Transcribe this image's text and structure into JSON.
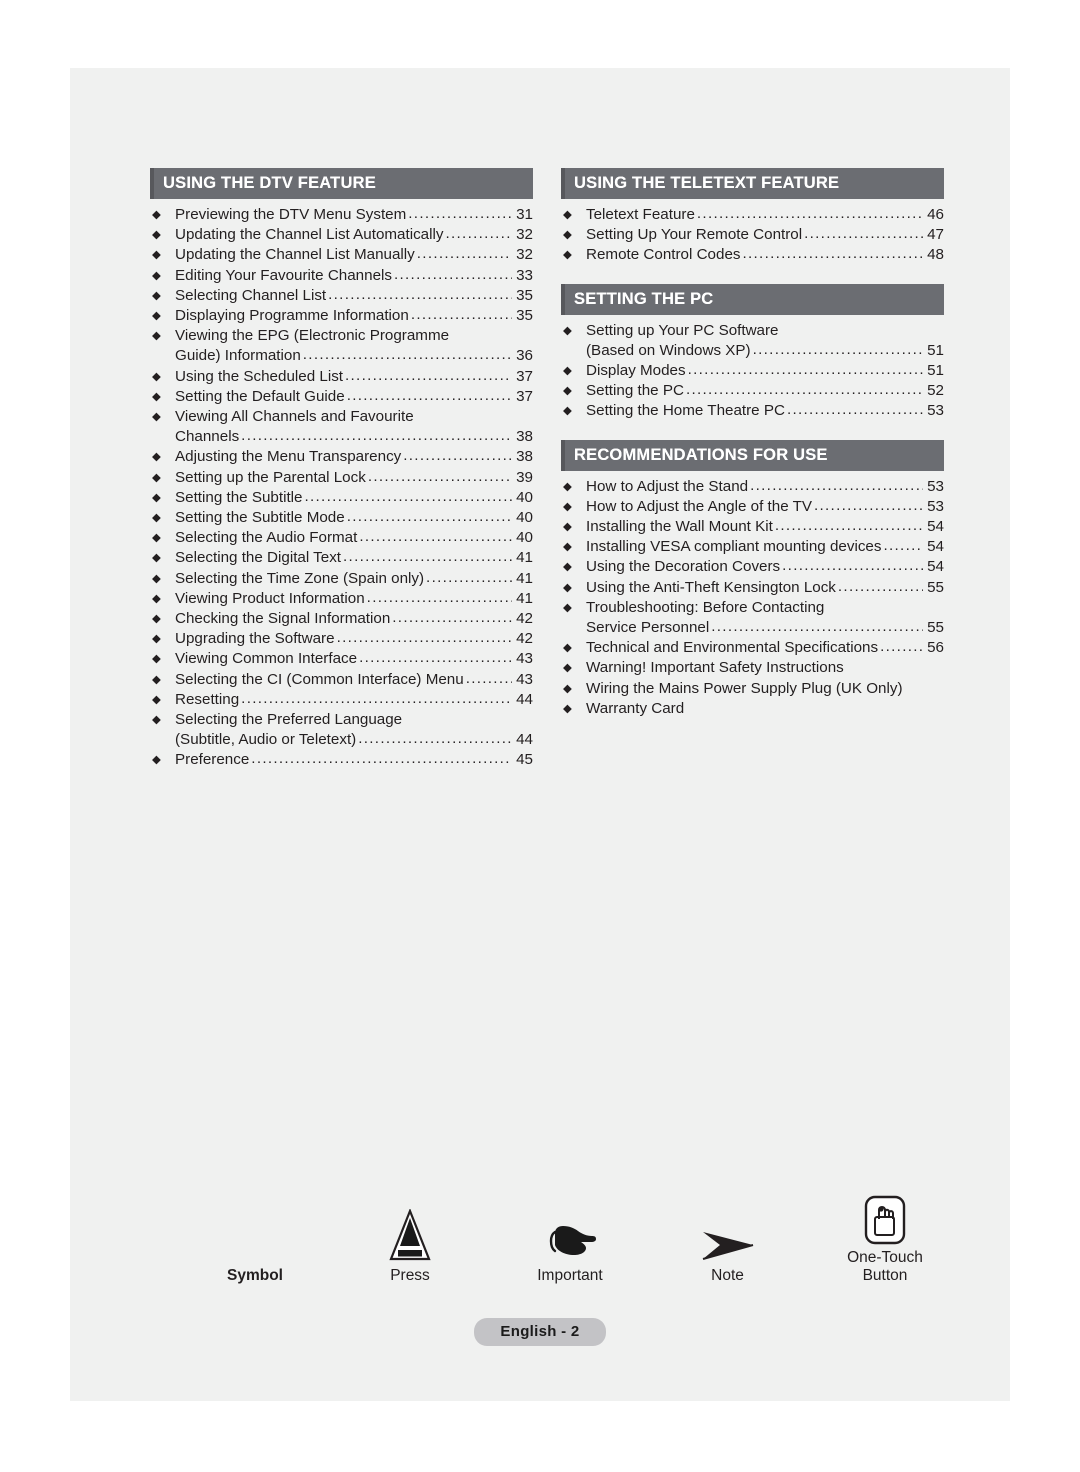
{
  "document": {
    "footer_label": "English - 2"
  },
  "colors": {
    "header_bar": "#6b6d72",
    "header_bar_accent": "#57585c",
    "page_background": "#f0f1f0",
    "footer_pill": "#c3c3c6",
    "text": "#231f20"
  },
  "left_column": [
    {
      "title": "USING THE DTV FEATURE",
      "entries": [
        {
          "lines": [
            "Previewing the DTV Menu System"
          ],
          "page": "31"
        },
        {
          "lines": [
            "Updating the Channel List Automatically"
          ],
          "page": "32"
        },
        {
          "lines": [
            "Updating the Channel List Manually"
          ],
          "page": "32"
        },
        {
          "lines": [
            "Editing Your Favourite Channels"
          ],
          "page": "33"
        },
        {
          "lines": [
            "Selecting Channel List"
          ],
          "page": "35"
        },
        {
          "lines": [
            "Displaying Programme Information"
          ],
          "page": "35"
        },
        {
          "lines": [
            "Viewing the EPG (Electronic Programme",
            "Guide) Information"
          ],
          "page": "36"
        },
        {
          "lines": [
            "Using the Scheduled List"
          ],
          "page": "37"
        },
        {
          "lines": [
            "Setting the Default Guide"
          ],
          "page": "37"
        },
        {
          "lines": [
            "Viewing All Channels and Favourite",
            "Channels"
          ],
          "page": "38"
        },
        {
          "lines": [
            "Adjusting the Menu Transparency"
          ],
          "page": "38"
        },
        {
          "lines": [
            "Setting up the Parental Lock"
          ],
          "page": "39"
        },
        {
          "lines": [
            "Setting the Subtitle"
          ],
          "page": "40"
        },
        {
          "lines": [
            "Setting the Subtitle Mode"
          ],
          "page": "40"
        },
        {
          "lines": [
            "Selecting the Audio Format"
          ],
          "page": "40"
        },
        {
          "lines": [
            "Selecting the Digital Text"
          ],
          "page": "41"
        },
        {
          "lines": [
            "Selecting the Time Zone (Spain only)"
          ],
          "page": "41"
        },
        {
          "lines": [
            "Viewing Product Information"
          ],
          "page": "41"
        },
        {
          "lines": [
            "Checking the Signal Information"
          ],
          "page": "42"
        },
        {
          "lines": [
            "Upgrading the Software"
          ],
          "page": "42"
        },
        {
          "lines": [
            "Viewing Common Interface"
          ],
          "page": "43"
        },
        {
          "lines": [
            "Selecting the CI (Common Interface) Menu"
          ],
          "page": "43"
        },
        {
          "lines": [
            "Resetting"
          ],
          "page": "44"
        },
        {
          "lines": [
            "Selecting the Preferred Language",
            "(Subtitle, Audio or Teletext)"
          ],
          "page": "44"
        },
        {
          "lines": [
            "Preference"
          ],
          "page": "45"
        }
      ]
    }
  ],
  "right_column": [
    {
      "title": "USING THE TELETEXT FEATURE",
      "entries": [
        {
          "lines": [
            "Teletext Feature"
          ],
          "page": "46"
        },
        {
          "lines": [
            "Setting Up Your Remote Control"
          ],
          "page": "47"
        },
        {
          "lines": [
            "Remote Control Codes"
          ],
          "page": "48"
        }
      ]
    },
    {
      "title": "SETTING THE PC",
      "entries": [
        {
          "lines": [
            "Setting up Your PC Software",
            "(Based on Windows XP)"
          ],
          "page": "51"
        },
        {
          "lines": [
            "Display Modes"
          ],
          "page": "51"
        },
        {
          "lines": [
            "Setting the PC"
          ],
          "page": "52"
        },
        {
          "lines": [
            "Setting the Home Theatre PC"
          ],
          "page": "53"
        }
      ]
    },
    {
      "title": "RECOMMENDATIONS FOR USE",
      "entries": [
        {
          "lines": [
            "How to Adjust the Stand"
          ],
          "page": "53"
        },
        {
          "lines": [
            "How to Adjust the Angle of the TV"
          ],
          "page": "53"
        },
        {
          "lines": [
            "Installing the Wall Mount Kit"
          ],
          "page": "54"
        },
        {
          "lines": [
            "Installing VESA compliant mounting devices"
          ],
          "page": "54"
        },
        {
          "lines": [
            "Using the Decoration Covers"
          ],
          "page": "54"
        },
        {
          "lines": [
            "Using the Anti-Theft Kensington Lock"
          ],
          "page": "55"
        },
        {
          "lines": [
            "Troubleshooting: Before Contacting",
            "Service Personnel"
          ],
          "page": "55"
        },
        {
          "lines": [
            "Technical and Environmental Specifications"
          ],
          "page": "56"
        },
        {
          "lines": [
            "Warning! Important Safety Instructions"
          ],
          "page": ""
        },
        {
          "lines": [
            "Wiring the Mains Power Supply Plug (UK Only)"
          ],
          "page": ""
        },
        {
          "lines": [
            "Warranty Card"
          ],
          "page": ""
        }
      ]
    }
  ],
  "legend": {
    "header_label": "Symbol",
    "items": [
      {
        "icon": "press-triangle-icon",
        "label": "Press"
      },
      {
        "icon": "pointing-hand-icon",
        "label": "Important"
      },
      {
        "icon": "arrow-note-icon",
        "label": "Note"
      },
      {
        "icon": "one-touch-button-icon",
        "label": "One-Touch\nButton"
      }
    ],
    "one_touch_line1": "One-Touch",
    "one_touch_line2": "Button"
  }
}
